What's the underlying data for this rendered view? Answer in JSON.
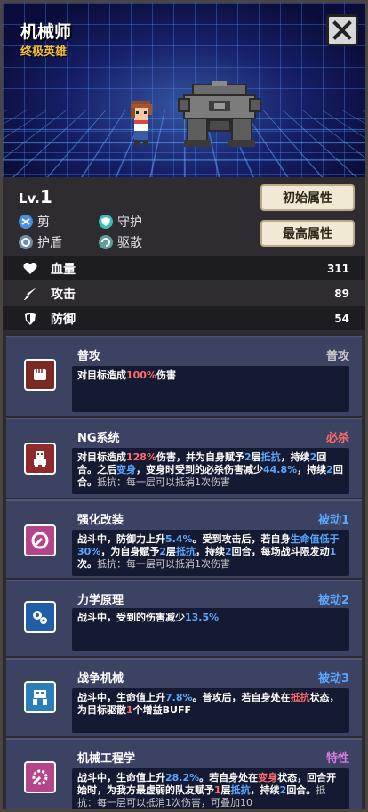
{
  "hero": {
    "name": "机械师",
    "rank": "终极英雄",
    "close_label": "✕"
  },
  "level": {
    "prefix": "Lv.",
    "value": "1"
  },
  "tags": [
    {
      "label": "剪",
      "icon": "scissors-icon",
      "color": "#4a8fe0"
    },
    {
      "label": "守护",
      "icon": "shield-icon",
      "color": "#3bc0b5"
    },
    {
      "label": "护盾",
      "icon": "barrier-icon",
      "color": "#6f8fa8"
    },
    {
      "label": "驱散",
      "icon": "dispel-icon",
      "color": "#5f9e9c"
    }
  ],
  "buttons": {
    "initial": "初始属性",
    "max": "最高属性"
  },
  "stats": [
    {
      "label": "血量",
      "value": "311",
      "icon": "heart-icon"
    },
    {
      "label": "攻击",
      "value": "89",
      "icon": "sword-icon"
    },
    {
      "label": "防御",
      "value": "54",
      "icon": "shield-defense-icon"
    }
  ],
  "skills": [
    {
      "name": "普攻",
      "type": "普攻",
      "type_color": "#c9c9c9",
      "icon": "fist-icon",
      "icon_bg": "#7a2a22",
      "desc": [
        {
          "t": "对目标造成"
        },
        {
          "t": "100%",
          "c": "red"
        },
        {
          "t": "伤害"
        }
      ]
    },
    {
      "name": "NG系统",
      "type": "必杀",
      "type_color": "#ff6b6b",
      "icon": "robot-icon",
      "icon_bg": "#8e2b2b",
      "desc": [
        {
          "t": "对目标造成"
        },
        {
          "t": "128%",
          "c": "red"
        },
        {
          "t": "伤害，并为自身赋予"
        },
        {
          "t": "2",
          "c": "blue"
        },
        {
          "t": "层"
        },
        {
          "t": "抵抗",
          "c": "blue"
        },
        {
          "t": "，持续"
        },
        {
          "t": "2",
          "c": "blue"
        },
        {
          "t": "回合。之后"
        },
        {
          "t": "变身",
          "c": "blue"
        },
        {
          "t": "，变身时受到的必杀伤害减少"
        },
        {
          "t": "44.8%",
          "c": "blue"
        },
        {
          "t": "，持续"
        },
        {
          "t": "2",
          "c": "blue"
        },
        {
          "t": "回合。"
        },
        {
          "t": "抵抗：每一层可以抵消1次伤害",
          "c": "grey"
        }
      ]
    },
    {
      "name": "强化改装",
      "type": "被动1",
      "type_color": "#5aa7ff",
      "icon": "wrench-gear-icon",
      "icon_bg": "#b5458a",
      "desc": [
        {
          "t": "战斗中，防御力上升"
        },
        {
          "t": "5.4%",
          "c": "blue"
        },
        {
          "t": "。受到攻击后，若自身"
        },
        {
          "t": "生命值低于30%",
          "c": "blue"
        },
        {
          "t": "，为自身赋予"
        },
        {
          "t": "2",
          "c": "blue"
        },
        {
          "t": "层"
        },
        {
          "t": "抵抗",
          "c": "blue"
        },
        {
          "t": "，持续"
        },
        {
          "t": "2",
          "c": "blue"
        },
        {
          "t": "回合，每场战斗限发动"
        },
        {
          "t": "1",
          "c": "blue"
        },
        {
          "t": "次。"
        },
        {
          "t": "抵抗：每一层可以抵消1次伤害",
          "c": "grey"
        }
      ]
    },
    {
      "name": "力学原理",
      "type": "被动2",
      "type_color": "#5aa7ff",
      "icon": "gears-icon",
      "icon_bg": "#1f5fa8",
      "desc": [
        {
          "t": "战斗中，受到的伤害减少"
        },
        {
          "t": "13.5%",
          "c": "blue"
        }
      ]
    },
    {
      "name": "战争机械",
      "type": "被动3",
      "type_color": "#5aa7ff",
      "icon": "war-mech-icon",
      "icon_bg": "#2a7fb8",
      "desc": [
        {
          "t": "战斗中，生命值上升"
        },
        {
          "t": "7.8%",
          "c": "blue"
        },
        {
          "t": "。普攻后，若自身处在"
        },
        {
          "t": "抵抗",
          "c": "red"
        },
        {
          "t": "状态，为目标驱散"
        },
        {
          "t": "1",
          "c": "red"
        },
        {
          "t": "个增益BUFF"
        }
      ]
    },
    {
      "name": "机械工程学",
      "type": "特性",
      "type_color": "#d67be0",
      "icon": "engineering-icon",
      "icon_bg": "#b5458a",
      "desc": [
        {
          "t": "战斗中，生命值上升"
        },
        {
          "t": "28.2%",
          "c": "blue"
        },
        {
          "t": "。若自身处在"
        },
        {
          "t": "变身",
          "c": "red"
        },
        {
          "t": "状态，回合开始时，为我方最虚弱的队友赋予"
        },
        {
          "t": "1",
          "c": "red"
        },
        {
          "t": "层"
        },
        {
          "t": "抵抗",
          "c": "blue"
        },
        {
          "t": "，持续"
        },
        {
          "t": "2",
          "c": "blue"
        },
        {
          "t": "回合。"
        },
        {
          "t": "抵抗：每一层可以抵消1次伤害，可叠加10",
          "c": "grey"
        }
      ]
    }
  ]
}
